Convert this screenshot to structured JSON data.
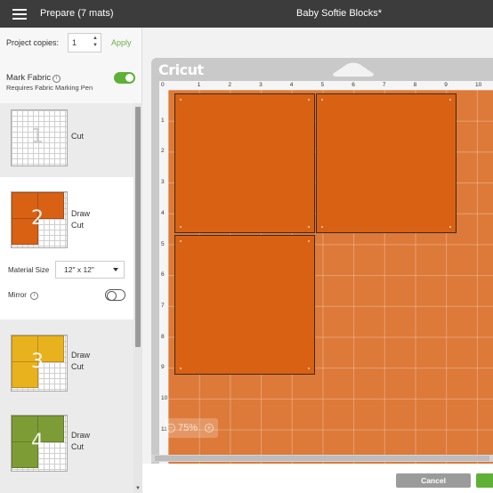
{
  "header": {
    "prepare_title": "Prepare (7 mats)",
    "project_title": "Baby Softie Blocks*"
  },
  "copies": {
    "label": "Project copies:",
    "value": "1",
    "apply_label": "Apply"
  },
  "mark_fabric": {
    "label": "Mark Fabric",
    "info_glyph": "i",
    "sublabel": "Requires Fabric Marking Pen",
    "enabled": true
  },
  "mats": [
    {
      "number": "1",
      "line1": "Cut",
      "line2": "",
      "color": "#ffffff"
    },
    {
      "number": "2",
      "line1": "Draw",
      "line2": "Cut",
      "color": "#d86114"
    },
    {
      "number": "3",
      "line1": "Draw",
      "line2": "Cut",
      "color": "#e8b21e"
    },
    {
      "number": "4",
      "line1": "Draw",
      "line2": "Cut",
      "color": "#7e9c35"
    }
  ],
  "material": {
    "size_label": "Material Size",
    "size_value": "12\" x 12\"",
    "mirror_label": "Mirror",
    "mirror_info": "i",
    "mirror_enabled": false
  },
  "canvas": {
    "logo": "Cricut",
    "ruler_top": [
      "0",
      "1",
      "2",
      "3",
      "4",
      "5",
      "6",
      "7",
      "8",
      "9",
      "10"
    ],
    "ruler_left": [
      "1",
      "2",
      "3",
      "4",
      "5",
      "6",
      "7",
      "8",
      "9",
      "10",
      "11"
    ],
    "mat_color": "#dd7a39",
    "block_color": "#d86114",
    "zoom": "75%",
    "zoom_minus": "−",
    "zoom_plus": "+"
  },
  "footer": {
    "cancel_label": "Cancel"
  },
  "colors": {
    "accent": "#5eb135",
    "header_bg": "#3c3c3c"
  }
}
